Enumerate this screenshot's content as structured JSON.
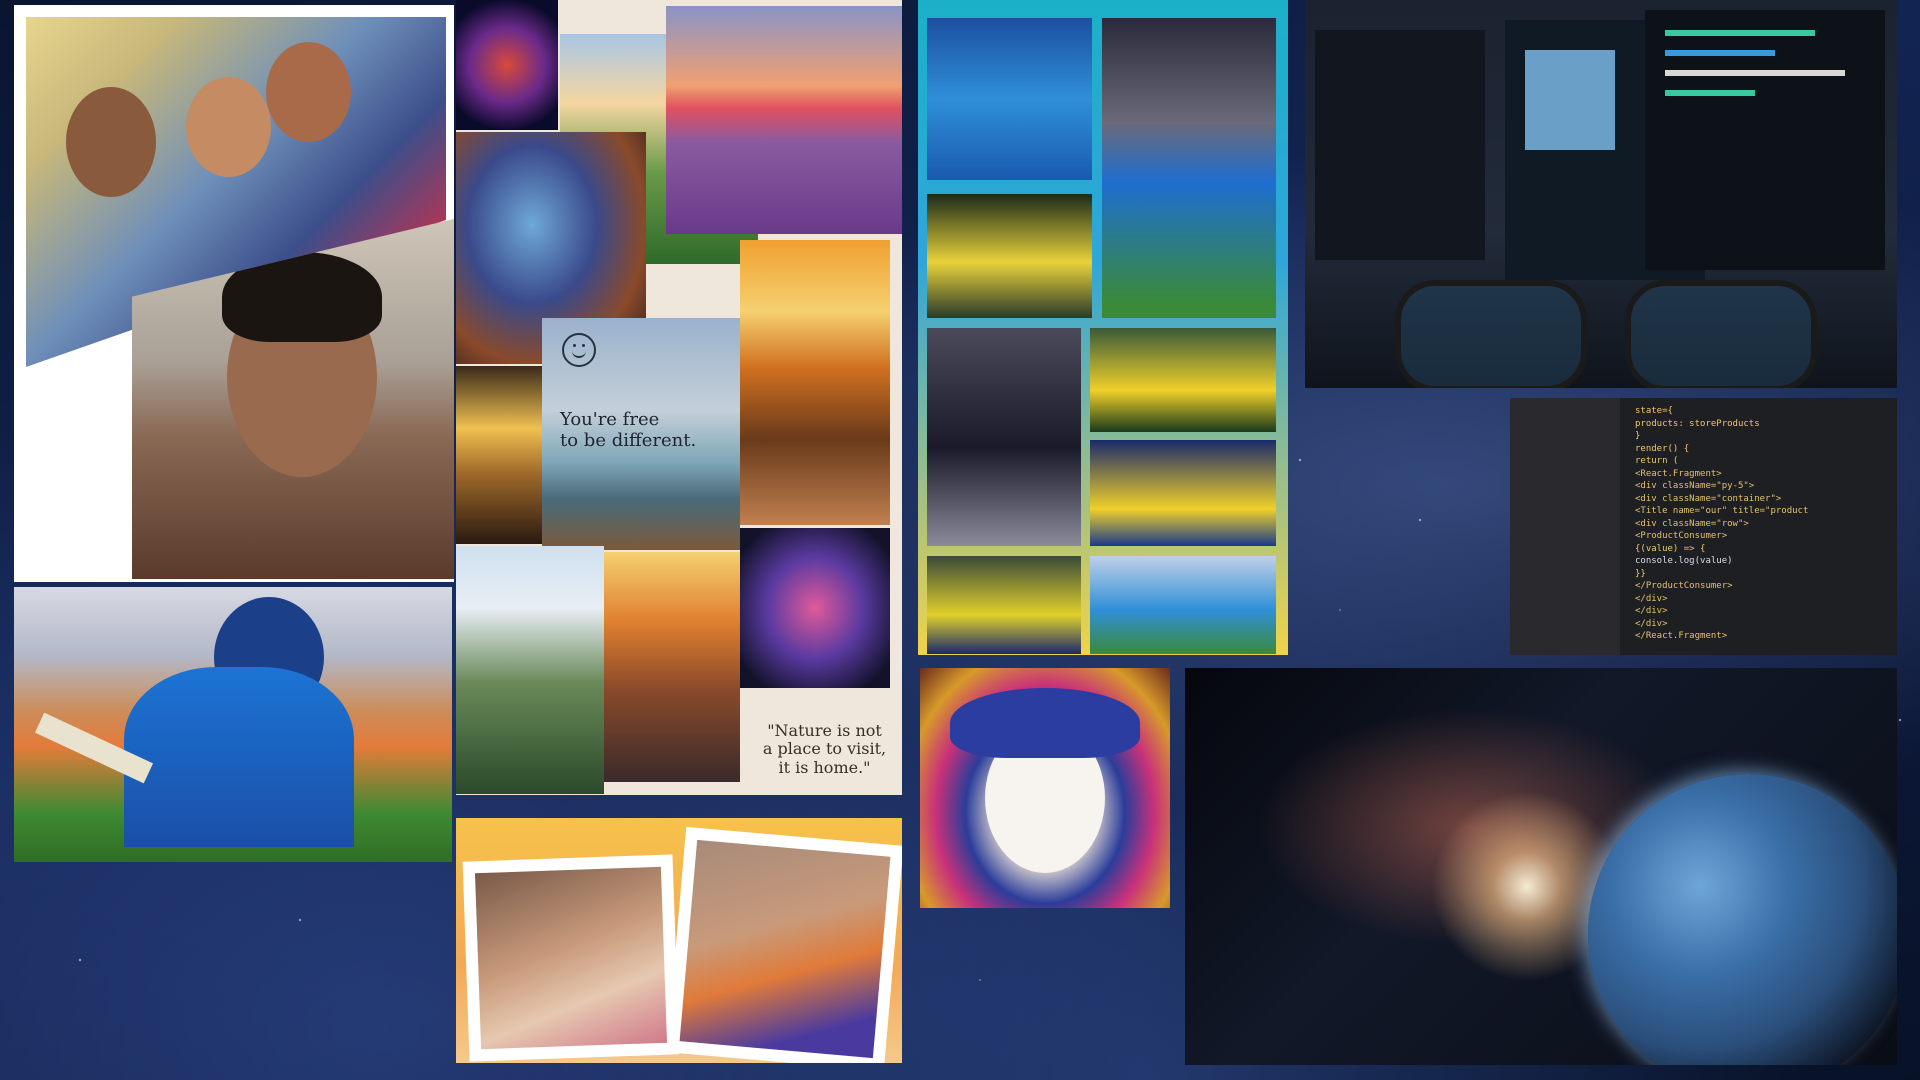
{
  "background": {
    "theme": "starry night sky",
    "accent": "#122452"
  },
  "nature_collage": {
    "quote_1_line_1": "You're free",
    "quote_1_line_2": "to be different.",
    "quote_2_line_1": "\"Nature is not",
    "quote_2_line_2": "a place to visit,",
    "quote_2_line_3": "it is home.\""
  },
  "code_screen": {
    "lines": [
      "state={",
      "  products: storeProducts",
      "}",
      "render() {",
      "  return (",
      "    <React.Fragment>",
      "      <div className=\"py-5\">",
      "        <div className=\"container\">",
      "          <Title name=\"our\" title=\"product",
      "          <div className=\"row\">",
      "            <ProductConsumer>",
      "              {(value) => {",
      "                console.log(value)",
      "              }}",
      "            </ProductConsumer>",
      "          </div>",
      "        </div>",
      "      </div>",
      "    </React.Fragment>"
    ]
  },
  "colors": {
    "code_keyword": "#f0c674",
    "code_tag": "#e3c16f",
    "code_text": "#d8dee9",
    "cricket_frame_top": "#1cb0c8",
    "cricket_frame_bottom": "#f0d34a"
  }
}
